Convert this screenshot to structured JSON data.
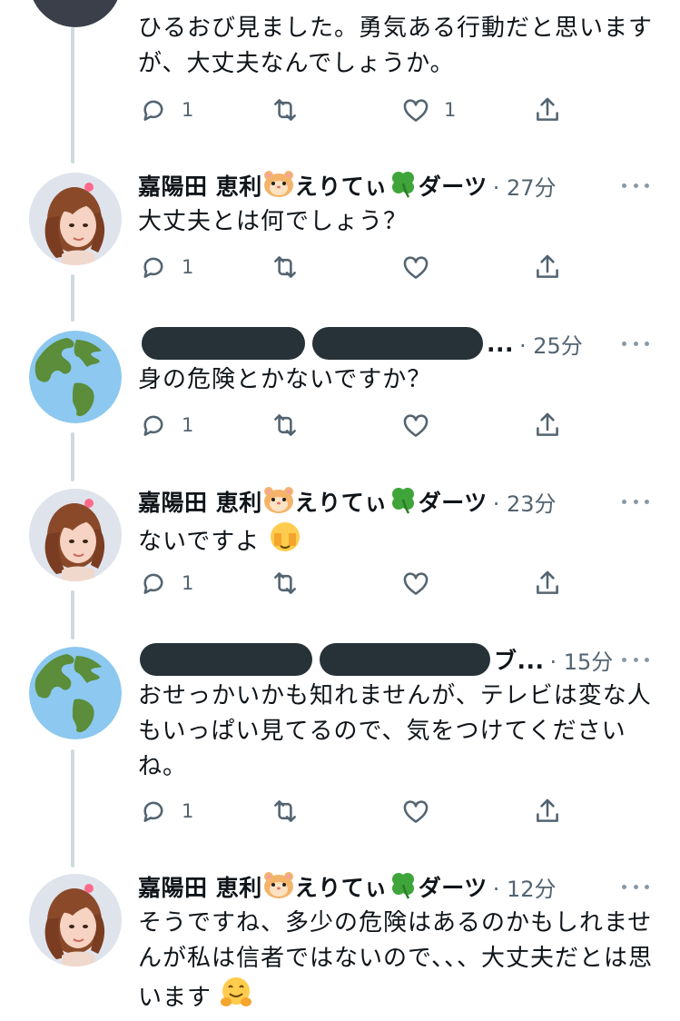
{
  "thread": [
    {
      "text": "ひるおび見ました。勇気ある行動だと思いますが、大丈夫なんでしょうか。",
      "reply_count": "1",
      "like_count": "1"
    },
    {
      "name": "嘉陽田 恵利",
      "name_suffix": "えりてぃ",
      "name_suffix2": "ダーツ",
      "time": "· 27分",
      "text": "大丈夫とは何でしょう？",
      "reply_count": "1"
    },
    {
      "name_tail": "...",
      "time": "· 25分",
      "text": "身の危険とかないですか？",
      "reply_count": "1"
    },
    {
      "name": "嘉陽田 恵利",
      "name_suffix": "えりてぃ",
      "name_suffix2": "ダーツ",
      "time": "· 23分",
      "text": "ないですよ",
      "reply_count": "1"
    },
    {
      "name_tail": "ブ...",
      "time": "· 15分",
      "text": "おせっかいかも知れませんが、テレビは変な人もいっぱい見てるので、気をつけてくださいね。",
      "reply_count": "1"
    },
    {
      "name": "嘉陽田 恵利",
      "name_suffix": "えりてぃ",
      "name_suffix2": "ダーツ",
      "time": "· 12分",
      "text": "そうですね、多少の危険はあるのかもしれませんが私は信者ではないので、、、大丈夫だとは思います"
    }
  ],
  "icons": {
    "reply": "reply-icon",
    "retweet": "retweet-icon",
    "like": "heart-icon",
    "share": "share-icon",
    "more": "more-icon",
    "globe_avatar": "globe-icon",
    "hamster": "hamster-emoji",
    "clover": "four-leaf-clover-emoji",
    "see_no_evil": "face-with-hands-emoji",
    "hugging": "hugging-face-emoji"
  },
  "colors": {
    "icon": "#536471",
    "thread_line": "#cfd9de",
    "redaction": "#263238"
  }
}
